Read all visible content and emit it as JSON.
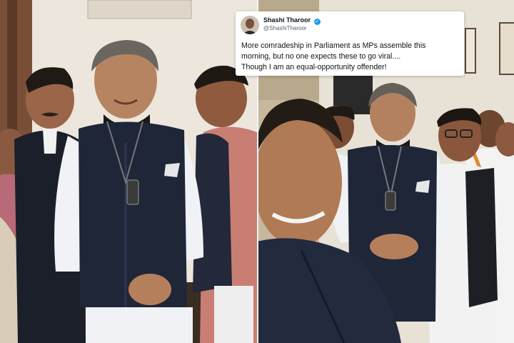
{
  "tweet": {
    "display_name": "Shashi Tharoor",
    "handle": "@ShashiTharoor",
    "verified_icon": "verified-badge-icon",
    "text_lines": [
      "More comradeship in Parliament as MPs assemble this",
      "morning, but no one expects these to go viral....",
      "Though I am an equal-opportunity offender!"
    ]
  },
  "colors": {
    "verified": "#1d9bf0",
    "vest_navy": "#1f2638",
    "kurta_white": "#f1f2f6",
    "wall_cream": "#ece6dc"
  }
}
